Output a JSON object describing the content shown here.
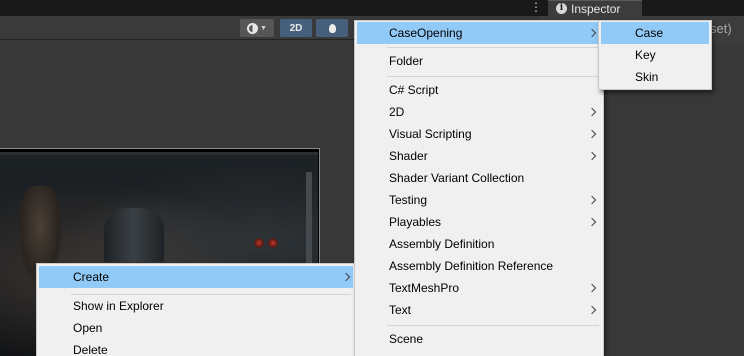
{
  "inspector_tab": {
    "label": "Inspector",
    "icon": "info-icon"
  },
  "inspector_peek": "set)",
  "scene_toolbar": {
    "orbit_icon": "orbit-icon",
    "mode_2d_label": "2D",
    "lighting_icon": "lightbulb-icon"
  },
  "colors": {
    "menu_bg": "#f0f0f0",
    "menu_highlight": "#91c9f7",
    "editor_bg": "#383838",
    "toolbar_active": "#46607c"
  },
  "create_menu": {
    "items": [
      {
        "label": "CaseOpening",
        "submenu": true,
        "highlighted": true
      },
      {
        "label": "Folder",
        "submenu": false
      },
      {
        "label": "C# Script",
        "submenu": false
      },
      {
        "label": "2D",
        "submenu": true
      },
      {
        "label": "Visual Scripting",
        "submenu": true
      },
      {
        "label": "Shader",
        "submenu": true
      },
      {
        "label": "Shader Variant Collection",
        "submenu": false
      },
      {
        "label": "Testing",
        "submenu": true
      },
      {
        "label": "Playables",
        "submenu": true
      },
      {
        "label": "Assembly Definition",
        "submenu": false
      },
      {
        "label": "Assembly Definition Reference",
        "submenu": false
      },
      {
        "label": "TextMeshPro",
        "submenu": true
      },
      {
        "label": "Text",
        "submenu": true
      },
      {
        "label": "Scene",
        "submenu": false
      }
    ]
  },
  "caseopening_menu": {
    "items": [
      {
        "label": "Case",
        "highlighted": true
      },
      {
        "label": "Key"
      },
      {
        "label": "Skin"
      }
    ]
  },
  "project_menu": {
    "items": [
      {
        "label": "Create",
        "submenu": true,
        "highlighted": true
      },
      {
        "label": "Show in Explorer"
      },
      {
        "label": "Open"
      },
      {
        "label": "Delete"
      }
    ]
  }
}
